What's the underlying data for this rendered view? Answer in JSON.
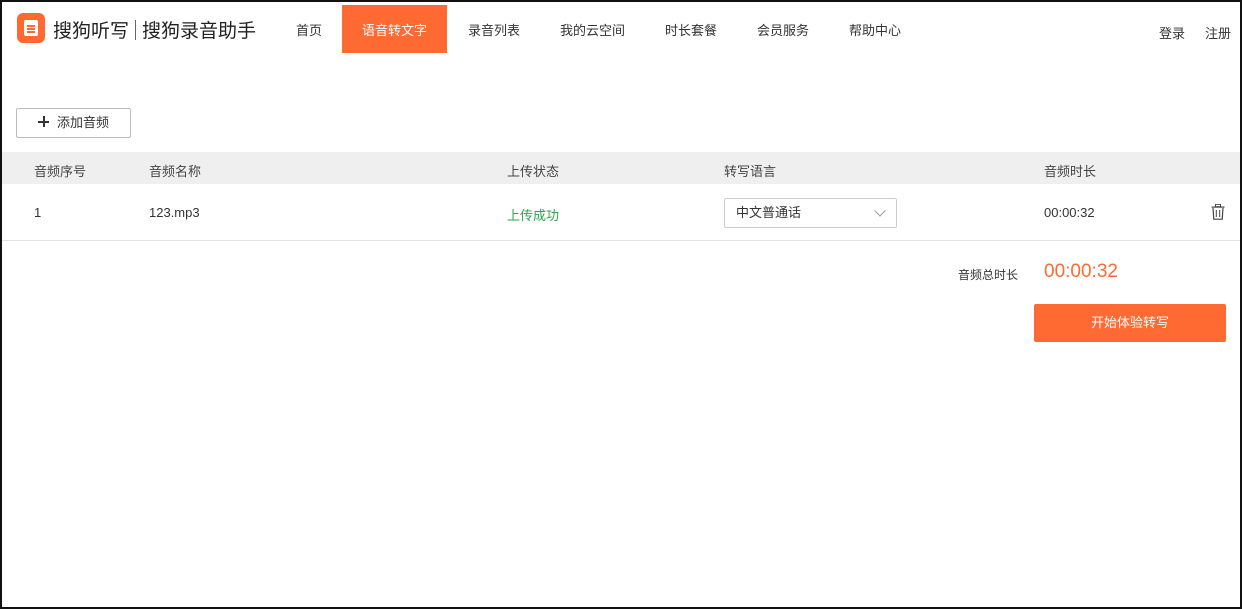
{
  "header": {
    "brand_primary": "搜狗听写",
    "brand_secondary": "搜狗录音助手",
    "nav": [
      {
        "label": "首页",
        "active": false
      },
      {
        "label": "语音转文字",
        "active": true
      },
      {
        "label": "录音列表",
        "active": false
      },
      {
        "label": "我的云空间",
        "active": false
      },
      {
        "label": "时长套餐",
        "active": false
      },
      {
        "label": "会员服务",
        "active": false
      },
      {
        "label": "帮助中心",
        "active": false
      }
    ],
    "login": "登录",
    "register": "注册"
  },
  "toolbar": {
    "add_audio_label": "添加音频"
  },
  "table": {
    "columns": [
      "音频序号",
      "音频名称",
      "上传状态",
      "转写语言",
      "音频时长"
    ],
    "rows": [
      {
        "index": "1",
        "name": "123.mp3",
        "status": "上传成功",
        "language": "中文普通话",
        "duration": "00:00:32"
      }
    ]
  },
  "summary": {
    "total_label": "音频总时长",
    "total_value": "00:00:32",
    "start_button": "开始体验转写"
  },
  "colors": {
    "accent": "#ff6a33",
    "success": "#2aa84a",
    "header_row_bg": "#efefef"
  },
  "icons": {
    "logo": "sogou-record-logo-icon",
    "add": "plus-icon",
    "dropdown": "chevron-down-icon",
    "delete": "trash-icon"
  }
}
